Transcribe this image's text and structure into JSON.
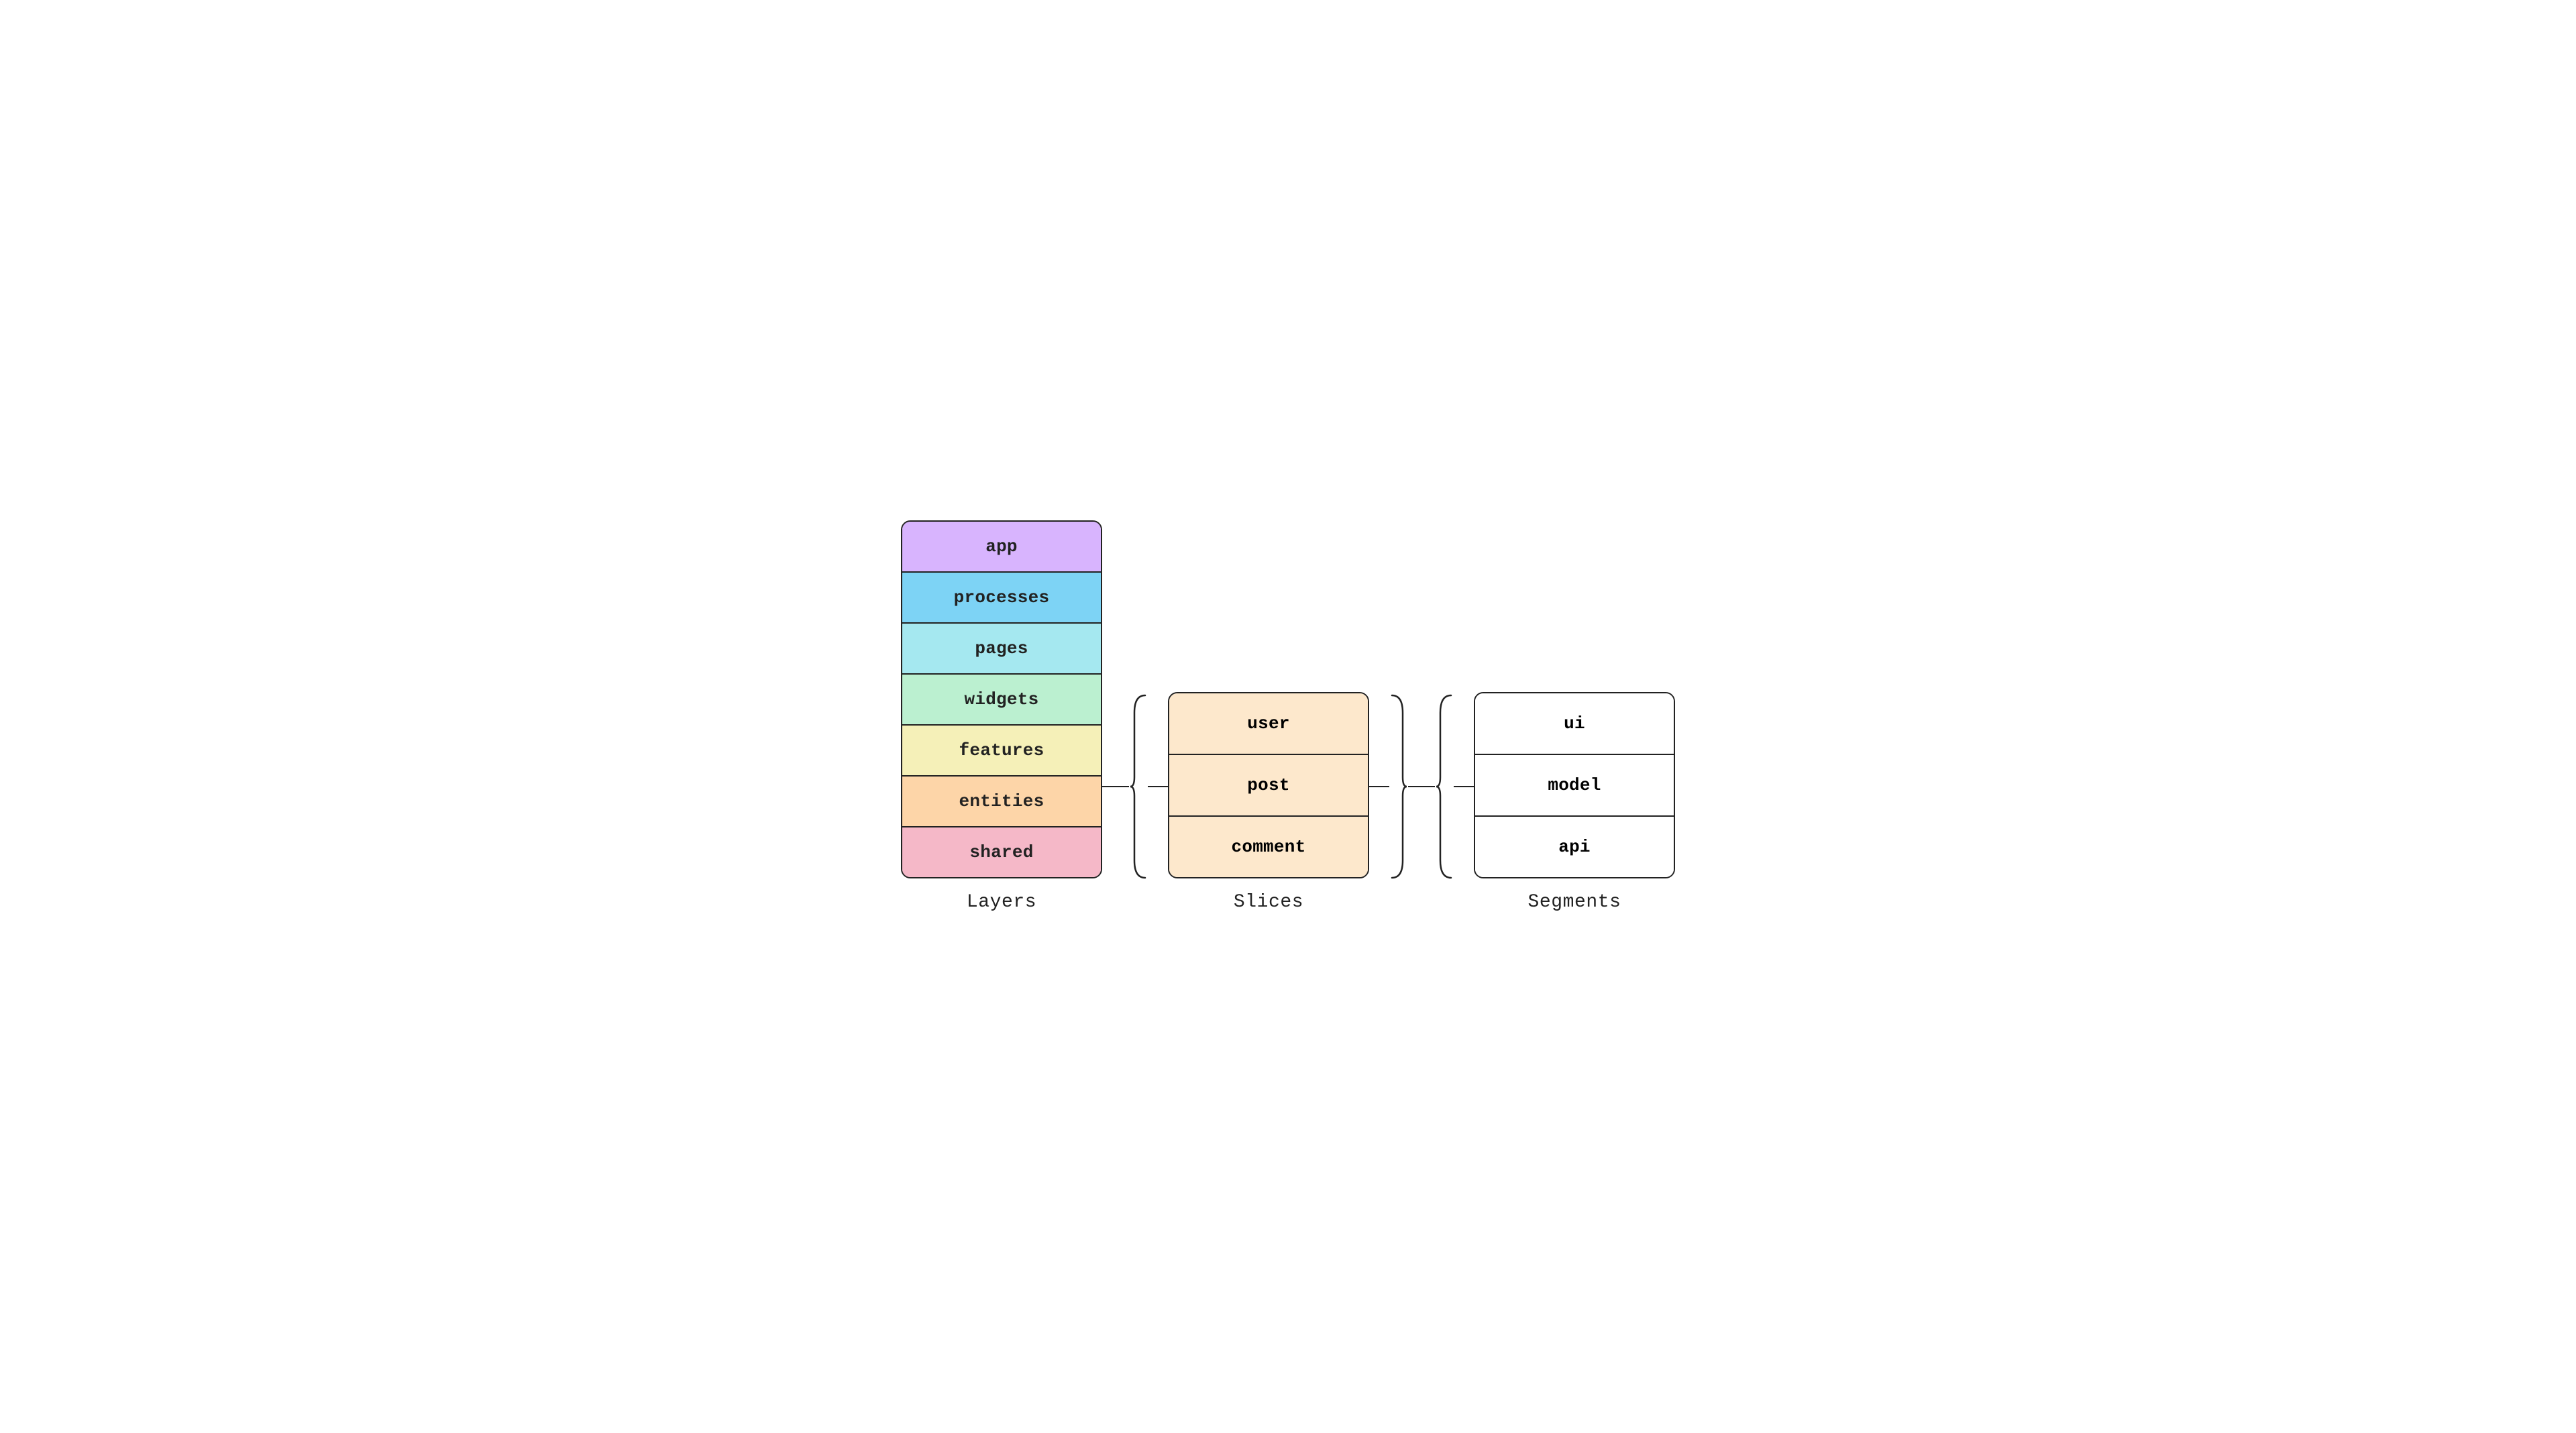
{
  "diagram": {
    "layers": {
      "label": "Layers",
      "items": [
        {
          "name": "app",
          "colorClass": "layer-app"
        },
        {
          "name": "processes",
          "colorClass": "layer-processes"
        },
        {
          "name": "pages",
          "colorClass": "layer-pages"
        },
        {
          "name": "widgets",
          "colorClass": "layer-widgets"
        },
        {
          "name": "features",
          "colorClass": "layer-features"
        },
        {
          "name": "entities",
          "colorClass": "layer-entities"
        },
        {
          "name": "shared",
          "colorClass": "layer-shared"
        }
      ]
    },
    "slices": {
      "label": "Slices",
      "items": [
        {
          "name": "user"
        },
        {
          "name": "post"
        },
        {
          "name": "comment"
        }
      ]
    },
    "segments": {
      "label": "Segments",
      "items": [
        {
          "name": "ui"
        },
        {
          "name": "model"
        },
        {
          "name": "api"
        }
      ]
    }
  }
}
